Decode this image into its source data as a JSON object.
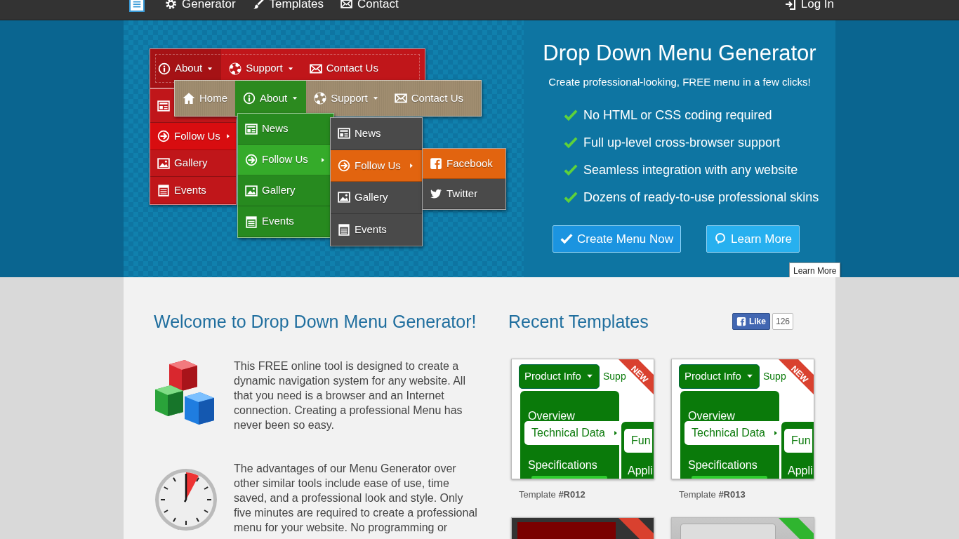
{
  "navbar": {
    "items": [
      {
        "label": "Generator"
      },
      {
        "label": "Templates"
      },
      {
        "label": "Contact"
      }
    ],
    "login": {
      "label": "Log In"
    }
  },
  "hero": {
    "demo_menus": [
      {
        "items": [
          {
            "label": "About",
            "selected": true
          },
          {
            "label": "Support",
            "selected": false
          },
          {
            "label": "Contact Us",
            "selected": false
          }
        ]
      },
      {
        "items": [
          {
            "selected": false
          },
          {
            "label": "Follow Us",
            "selected": true
          },
          {
            "label": "Gallery",
            "selected": false
          },
          {
            "label": "Events",
            "selected": false
          }
        ]
      },
      {
        "items": [
          {
            "label": "Home",
            "selected": false
          },
          {
            "label": "About",
            "selected": true
          },
          {
            "label": "Support",
            "selected": false
          },
          {
            "label": "Contact Us",
            "selected": false
          }
        ]
      },
      {
        "items": [
          {
            "label": "News",
            "selected": false
          },
          {
            "label": "Follow Us",
            "selected": true
          },
          {
            "label": "Gallery",
            "selected": false
          },
          {
            "label": "Events",
            "selected": false
          }
        ]
      },
      {
        "items": [
          {
            "label": "News",
            "selected": false
          },
          {
            "label": "Follow Us",
            "selected": true
          },
          {
            "label": "Gallery",
            "selected": false
          },
          {
            "label": "Events",
            "selected": false
          }
        ]
      },
      {
        "items": [
          {
            "label": "Facebook",
            "selected": true
          },
          {
            "label": "Twitter",
            "selected": false
          }
        ]
      }
    ],
    "title": "Drop Down Menu Generator",
    "subtitle": "Create professional-looking, FREE menu in a few clicks!",
    "features": [
      "No HTML or CSS coding required",
      "Full up-level cross-browser support",
      "Seamless integration with any website",
      "Dozens of ready-to-use professional skins"
    ],
    "buttons": [
      {
        "label": "Create Menu Now",
        "kind": "primary"
      },
      {
        "label": "Learn More",
        "kind": "secondary"
      }
    ],
    "tooltip": "Learn More"
  },
  "welcome": {
    "title": "Welcome to Drop Down Menu Generator!",
    "features": [
      {
        "kind": "cubes",
        "text": "This FREE online tool is designed to create a dynamic navigation system for any website. All that you need is a browser and an Internet connection. Creating a professional Menu has never been so easy."
      },
      {
        "kind": "clock",
        "text": "The advantages of our Menu Generator over other similar tools include ease of use, time saved, and a professional look and style. Only five minutes are required to create a professional menu for your website. No programming or"
      }
    ]
  },
  "templates": {
    "title": "Recent Templates",
    "like": {
      "label": "Like",
      "count": "126"
    },
    "items": [
      {
        "kind": "green",
        "ribbon": {
          "text": "NEW",
          "color": "#d9412f"
        },
        "menu": {
          "button": "Product Info",
          "next": "Supp",
          "items": [
            "Overview",
            "Technical Data",
            "Specifications"
          ],
          "sub_items": [
            "Fun",
            "Appli"
          ]
        },
        "caption": "Template **#R012**"
      },
      {
        "kind": "green",
        "ribbon": {
          "text": "NEW",
          "color": "#d9412f"
        },
        "menu": {
          "button": "Product Info",
          "next": "Supp",
          "items": [
            "Overview",
            "Technical Data",
            "Specifications"
          ],
          "sub_items": [
            "Fun",
            "Appli"
          ]
        },
        "caption": "Template **#R013**"
      },
      {
        "kind": "maroon",
        "ribbon": {
          "color": "#d9412f"
        }
      },
      {
        "kind": "silver",
        "ribbon": {
          "color": "#2fb52f"
        }
      }
    ]
  }
}
